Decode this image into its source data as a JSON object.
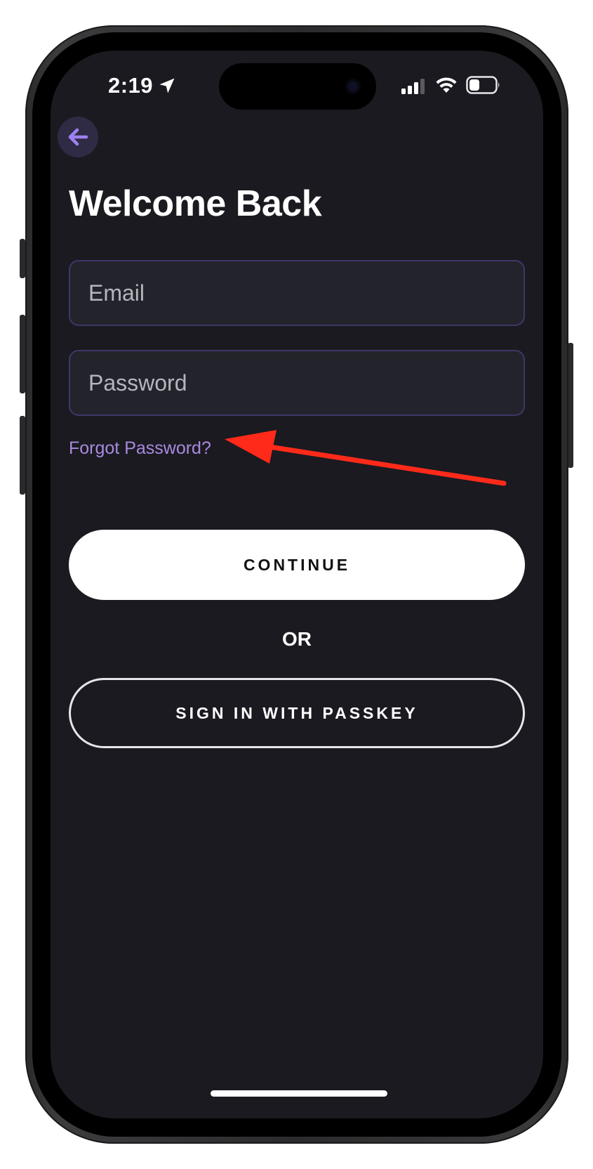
{
  "status_bar": {
    "time": "2:19",
    "location_icon": "location-arrow-icon",
    "signal_icon": "cellular-signal-icon",
    "wifi_icon": "wifi-icon",
    "battery_icon": "battery-icon",
    "battery_level": 0.4
  },
  "nav": {
    "back_icon": "arrow-left-icon"
  },
  "login": {
    "title": "Welcome Back",
    "email_placeholder": "Email",
    "password_placeholder": "Password",
    "forgot_password": "Forgot Password?",
    "continue_label": "CONTINUE",
    "or_label": "OR",
    "passkey_label": "SIGN IN WITH PASSKEY"
  },
  "annotation": {
    "arrow_icon": "red-annotation-arrow",
    "color": "#ff2a1a"
  },
  "colors": {
    "screen_background": "#1a1a20",
    "accent": "#a98ae0",
    "field_border": "#3e3768"
  }
}
